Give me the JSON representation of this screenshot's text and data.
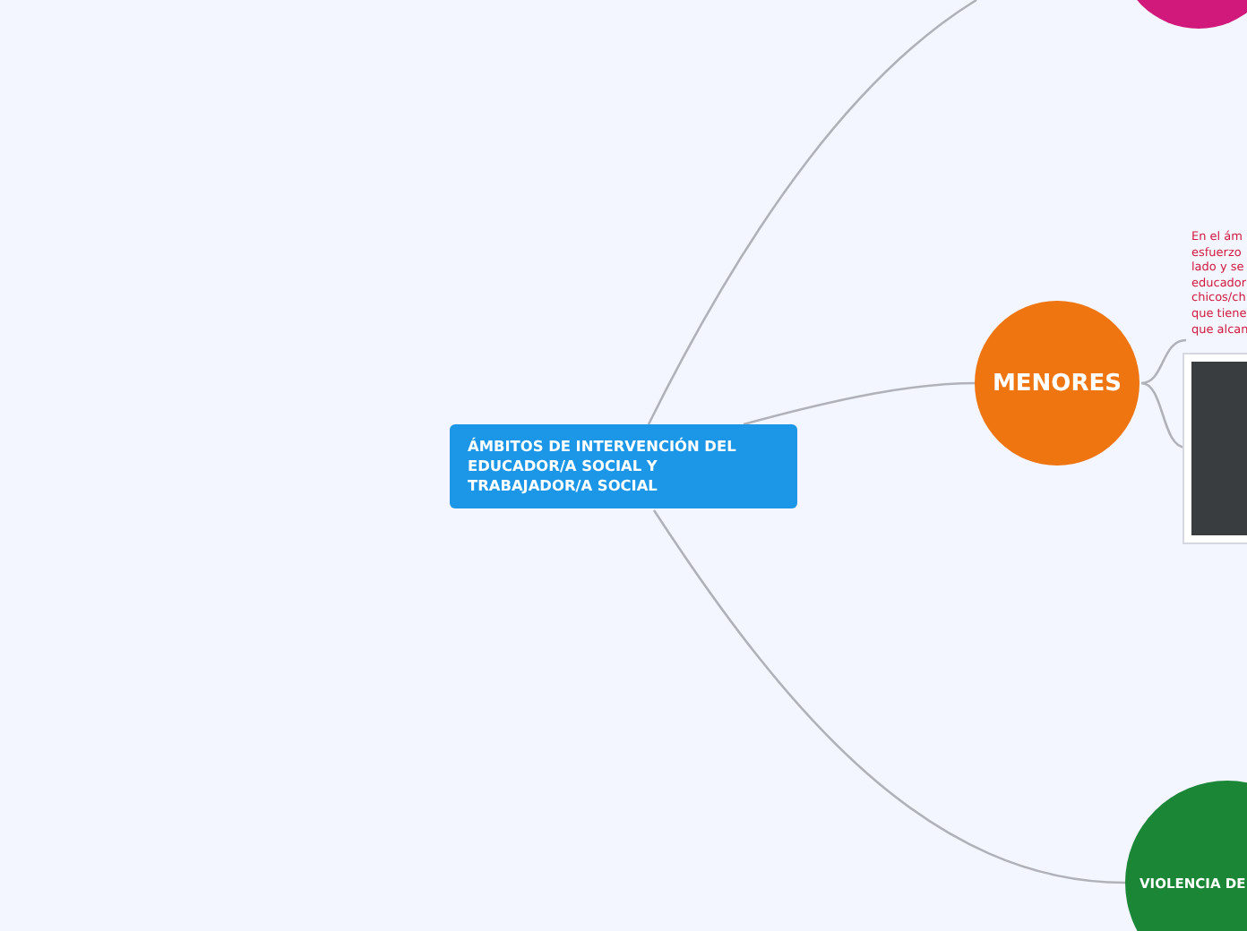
{
  "root": {
    "title": "ÁMBITOS DE INTERVENCIÓN DEL EDUCADOR/A SOCIAL Y TRABAJADOR/A SOCIAL"
  },
  "topics": [
    {
      "kind": "top",
      "color": "#d0197a"
    },
    {
      "kind": "middle",
      "label": "MENORES",
      "color": "#ee750f"
    },
    {
      "kind": "bottom",
      "label": "VIOLENCIA DE",
      "color": "#1a8636"
    }
  ],
  "note": {
    "lines": [
      "En el ám",
      "esfuerzo",
      "lado y se",
      "educador",
      "chicos/ch",
      "que tiene",
      "que alcan"
    ]
  }
}
